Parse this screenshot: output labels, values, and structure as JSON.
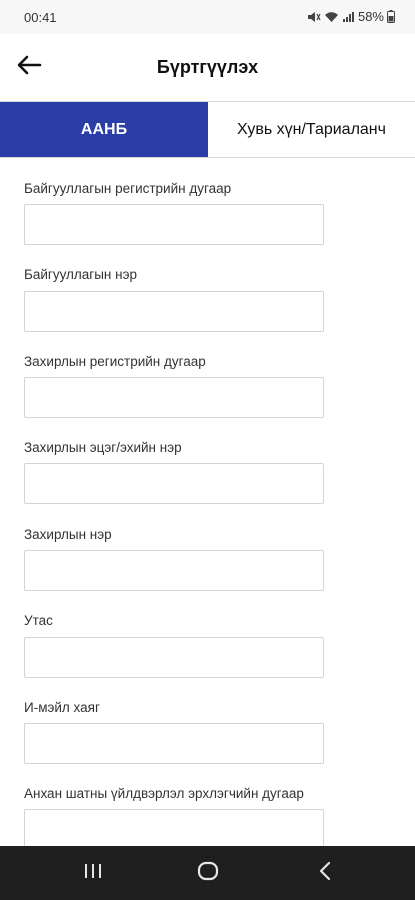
{
  "status_bar": {
    "time": "00:41",
    "battery": "58%"
  },
  "header": {
    "title": "Бүртгүүлэх",
    "back_icon": "arrow-left-icon"
  },
  "tabs": [
    {
      "label": "ААНБ",
      "active": true
    },
    {
      "label": "Хувь хүн/Тариаланч",
      "active": false
    }
  ],
  "form": {
    "fields": [
      {
        "label": "Байгууллагын регистрийн дугаар",
        "value": ""
      },
      {
        "label": "Байгууллагын нэр",
        "value": ""
      },
      {
        "label": "Захирлын регистрийн дугаар",
        "value": ""
      },
      {
        "label": "Захирлын эцэг/эхийн нэр",
        "value": ""
      },
      {
        "label": "Захирлын нэр",
        "value": ""
      },
      {
        "label": "Утас",
        "value": ""
      },
      {
        "label": "И-мэйл хаяг",
        "value": ""
      },
      {
        "label": "Анхан шатны үйлдвэрлэл эрхлэгчийн дугаар",
        "value": ""
      }
    ]
  },
  "colors": {
    "accent": "#2b3ea8",
    "nav_bar": "#1f1f1f"
  },
  "nav_bar": {
    "icons": [
      "recent-apps-icon",
      "home-icon",
      "back-nav-icon"
    ]
  }
}
